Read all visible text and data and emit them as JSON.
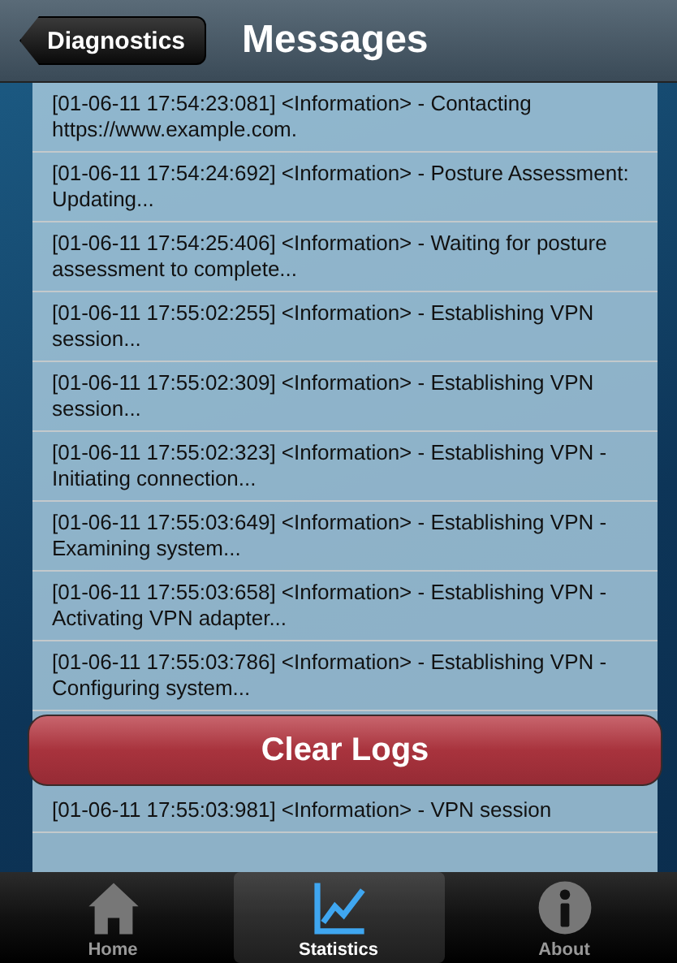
{
  "nav": {
    "back": "Diagnostics",
    "title": "Messages"
  },
  "messages": [
    {
      "text": "[01-06-11 17:54:23:081] <Information> - Contacting https://www.example.com."
    },
    {
      "text": "[01-06-11 17:54:24:692] <Information> - Posture Assessment: Updating..."
    },
    {
      "text": "[01-06-11 17:54:25:406] <Information> - Waiting for posture assessment to complete..."
    },
    {
      "text": "[01-06-11 17:55:02:255] <Information> - Establishing VPN session..."
    },
    {
      "text": "[01-06-11 17:55:02:309] <Information> - Establishing VPN session..."
    },
    {
      "text": "[01-06-11 17:55:02:323] <Information> - Establishing VPN - Initiating connection..."
    },
    {
      "text": "[01-06-11 17:55:03:649] <Information> - Establishing VPN - Examining system..."
    },
    {
      "text": "[01-06-11 17:55:03:658] <Information> - Establishing VPN - Activating VPN adapter..."
    },
    {
      "text": "[01-06-11 17:55:03:786] <Information> - Establishing VPN - Configuring system..."
    }
  ],
  "clear_button": "Clear Logs",
  "last_message": "[01-06-11 17:55:03:981] <Information> - VPN session",
  "tabs": [
    {
      "label": "Home",
      "kind": "home",
      "selected": false
    },
    {
      "label": "Statistics",
      "kind": "chart",
      "selected": true
    },
    {
      "label": "About",
      "kind": "info",
      "selected": false
    }
  ]
}
